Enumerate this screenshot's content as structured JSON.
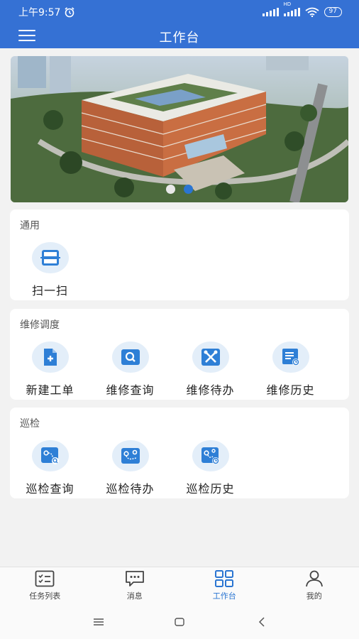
{
  "status": {
    "time": "上午9:57",
    "battery": "97",
    "network": "HD"
  },
  "header": {
    "title": "工作台"
  },
  "banner": {
    "dots": 2,
    "active": 1
  },
  "sections": [
    {
      "title": "通用",
      "items": [
        {
          "label": "扫一扫",
          "icon": "scan-icon"
        }
      ]
    },
    {
      "title": "维修调度",
      "items": [
        {
          "label": "新建工单",
          "icon": "new-order-icon"
        },
        {
          "label": "维修查询",
          "icon": "repair-search-icon"
        },
        {
          "label": "维修待办",
          "icon": "repair-tools-icon"
        },
        {
          "label": "维修历史",
          "icon": "repair-history-icon"
        }
      ]
    },
    {
      "title": "巡检",
      "items": [
        {
          "label": "巡检查询",
          "icon": "inspection-search-icon"
        },
        {
          "label": "巡检待办",
          "icon": "inspection-todo-icon"
        },
        {
          "label": "巡检历史",
          "icon": "inspection-history-icon"
        }
      ]
    }
  ],
  "tabbar": [
    {
      "label": "任务列表",
      "icon": "task-list-icon"
    },
    {
      "label": "消息",
      "icon": "message-icon"
    },
    {
      "label": "工作台",
      "icon": "workbench-icon",
      "active": true
    },
    {
      "label": "我的",
      "icon": "profile-icon"
    }
  ],
  "colors": {
    "primary": "#3571d4",
    "accent": "#2a75d2",
    "icon_bg": "#e3eef9"
  }
}
